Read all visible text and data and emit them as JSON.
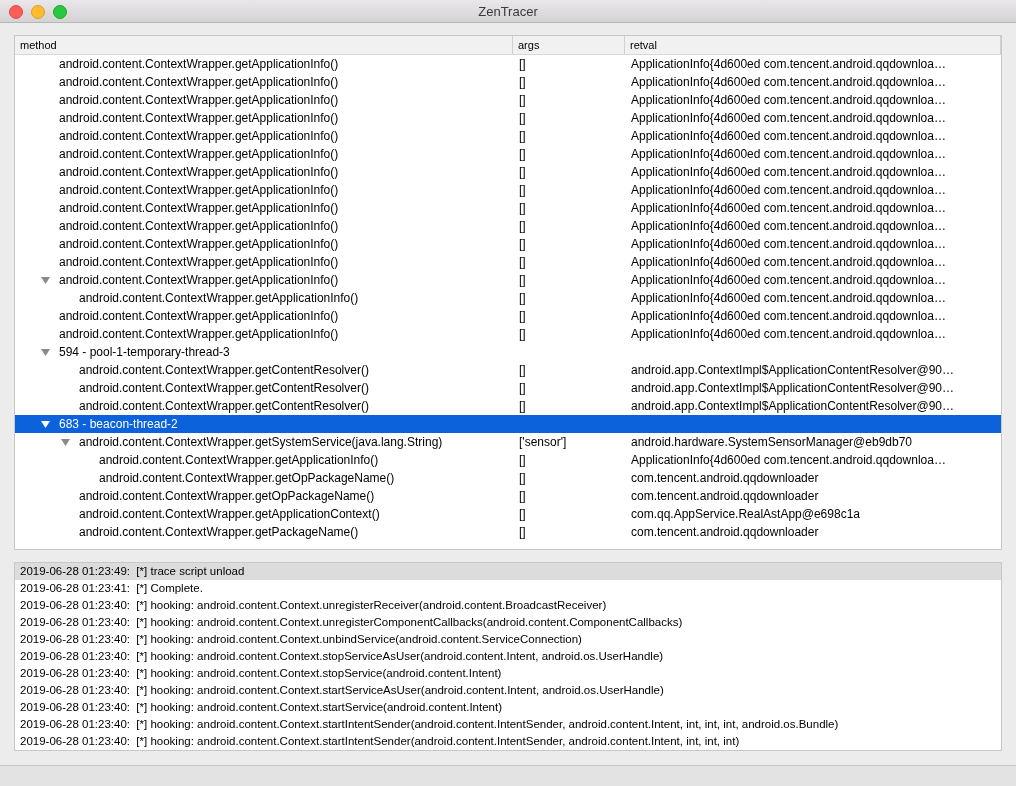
{
  "window": {
    "title": "ZenTracer"
  },
  "table": {
    "columns": [
      "method",
      "args",
      "retval"
    ],
    "tree": [
      {
        "children": [
          {
            "method": "android.content.ContextWrapper.getApplicationInfo()",
            "args": "[]",
            "retval": "ApplicationInfo{4d600ed com.tencent.android.qqdownloa…",
            "selected": false
          },
          {
            "method": "android.content.ContextWrapper.getApplicationInfo()",
            "args": "[]",
            "retval": "ApplicationInfo{4d600ed com.tencent.android.qqdownloa…",
            "selected": false
          },
          {
            "method": "android.content.ContextWrapper.getApplicationInfo()",
            "args": "[]",
            "retval": "ApplicationInfo{4d600ed com.tencent.android.qqdownloa…",
            "selected": false
          },
          {
            "method": "android.content.ContextWrapper.getApplicationInfo()",
            "args": "[]",
            "retval": "ApplicationInfo{4d600ed com.tencent.android.qqdownloa…",
            "selected": false
          },
          {
            "method": "android.content.ContextWrapper.getApplicationInfo()",
            "args": "[]",
            "retval": "ApplicationInfo{4d600ed com.tencent.android.qqdownloa…",
            "selected": false
          },
          {
            "method": "android.content.ContextWrapper.getApplicationInfo()",
            "args": "[]",
            "retval": "ApplicationInfo{4d600ed com.tencent.android.qqdownloa…",
            "selected": false
          },
          {
            "method": "android.content.ContextWrapper.getApplicationInfo()",
            "args": "[]",
            "retval": "ApplicationInfo{4d600ed com.tencent.android.qqdownloa…",
            "selected": false
          },
          {
            "method": "android.content.ContextWrapper.getApplicationInfo()",
            "args": "[]",
            "retval": "ApplicationInfo{4d600ed com.tencent.android.qqdownloa…",
            "selected": false
          },
          {
            "method": "android.content.ContextWrapper.getApplicationInfo()",
            "args": "[]",
            "retval": "ApplicationInfo{4d600ed com.tencent.android.qqdownloa…",
            "selected": false
          },
          {
            "method": "android.content.ContextWrapper.getApplicationInfo()",
            "args": "[]",
            "retval": "ApplicationInfo{4d600ed com.tencent.android.qqdownloa…",
            "selected": false
          },
          {
            "method": "android.content.ContextWrapper.getApplicationInfo()",
            "args": "[]",
            "retval": "ApplicationInfo{4d600ed com.tencent.android.qqdownloa…",
            "selected": false
          },
          {
            "method": "android.content.ContextWrapper.getApplicationInfo()",
            "args": "[]",
            "retval": "ApplicationInfo{4d600ed com.tencent.android.qqdownloa…",
            "selected": false
          },
          {
            "method": "android.content.ContextWrapper.getApplicationInfo()",
            "args": "[]",
            "retval": "ApplicationInfo{4d600ed com.tencent.android.qqdownloa…",
            "selected": false,
            "expanded": true,
            "children": [
              {
                "method": "android.content.ContextWrapper.getApplicationInfo()",
                "args": "[]",
                "retval": "ApplicationInfo{4d600ed com.tencent.android.qqdownloa…",
                "selected": false
              }
            ]
          },
          {
            "method": "android.content.ContextWrapper.getApplicationInfo()",
            "args": "[]",
            "retval": "ApplicationInfo{4d600ed com.tencent.android.qqdownloa…",
            "selected": false
          },
          {
            "method": "android.content.ContextWrapper.getApplicationInfo()",
            "args": "[]",
            "retval": "ApplicationInfo{4d600ed com.tencent.android.qqdownloa…",
            "selected": false
          }
        ]
      },
      {
        "method": "594 - pool-1-temporary-thread-3",
        "selected": false,
        "expanded": true,
        "children": [
          {
            "method": "android.content.ContextWrapper.getContentResolver()",
            "args": "[]",
            "retval": "android.app.ContextImpl$ApplicationContentResolver@90…",
            "selected": false
          },
          {
            "method": "android.content.ContextWrapper.getContentResolver()",
            "args": "[]",
            "retval": "android.app.ContextImpl$ApplicationContentResolver@90…",
            "selected": false
          },
          {
            "method": "android.content.ContextWrapper.getContentResolver()",
            "args": "[]",
            "retval": "android.app.ContextImpl$ApplicationContentResolver@90…",
            "selected": false
          }
        ]
      },
      {
        "method": "683 - beacon-thread-2",
        "selected": true,
        "expanded": true,
        "children": [
          {
            "method": "android.content.ContextWrapper.getSystemService(java.lang.String)",
            "args": "['sensor']",
            "retval": "android.hardware.SystemSensorManager@eb9db70",
            "selected": false,
            "expanded": true,
            "children": [
              {
                "method": "android.content.ContextWrapper.getApplicationInfo()",
                "args": "[]",
                "retval": "ApplicationInfo{4d600ed com.tencent.android.qqdownloa…",
                "selected": false
              },
              {
                "method": "android.content.ContextWrapper.getOpPackageName()",
                "args": "[]",
                "retval": "com.tencent.android.qqdownloader",
                "selected": false
              }
            ]
          },
          {
            "method": "android.content.ContextWrapper.getOpPackageName()",
            "args": "[]",
            "retval": "com.tencent.android.qqdownloader",
            "selected": false
          },
          {
            "method": "android.content.ContextWrapper.getApplicationContext()",
            "args": "[]",
            "retval": "com.qq.AppService.RealAstApp@e698c1a",
            "selected": false
          },
          {
            "method": "android.content.ContextWrapper.getPackageName()",
            "args": "[]",
            "retval": "com.tencent.android.qqdownloader",
            "selected": false
          }
        ]
      }
    ]
  },
  "log": [
    {
      "text": "2019-06-28 01:23:49:  [*] trace script unload",
      "selected": true
    },
    {
      "text": "2019-06-28 01:23:41:  [*] Complete.",
      "selected": false
    },
    {
      "text": "2019-06-28 01:23:40:  [*] hooking: android.content.Context.unregisterReceiver(android.content.BroadcastReceiver)",
      "selected": false
    },
    {
      "text": "2019-06-28 01:23:40:  [*] hooking: android.content.Context.unregisterComponentCallbacks(android.content.ComponentCallbacks)",
      "selected": false
    },
    {
      "text": "2019-06-28 01:23:40:  [*] hooking: android.content.Context.unbindService(android.content.ServiceConnection)",
      "selected": false
    },
    {
      "text": "2019-06-28 01:23:40:  [*] hooking: android.content.Context.stopServiceAsUser(android.content.Intent, android.os.UserHandle)",
      "selected": false
    },
    {
      "text": "2019-06-28 01:23:40:  [*] hooking: android.content.Context.stopService(android.content.Intent)",
      "selected": false
    },
    {
      "text": "2019-06-28 01:23:40:  [*] hooking: android.content.Context.startServiceAsUser(android.content.Intent, android.os.UserHandle)",
      "selected": false
    },
    {
      "text": "2019-06-28 01:23:40:  [*] hooking: android.content.Context.startService(android.content.Intent)",
      "selected": false
    },
    {
      "text": "2019-06-28 01:23:40:  [*] hooking: android.content.Context.startIntentSender(android.content.IntentSender, android.content.Intent, int, int, int, android.os.Bundle)",
      "selected": false
    },
    {
      "text": "2019-06-28 01:23:40:  [*] hooking: android.content.Context.startIntentSender(android.content.IntentSender, android.content.Intent, int, int, int)",
      "selected": false
    }
  ]
}
